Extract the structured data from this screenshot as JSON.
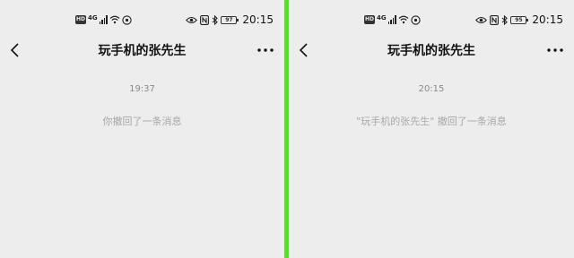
{
  "status_bar": {
    "hd_badge": "HD",
    "signal_type": "4G",
    "time": "20:15",
    "icons": [
      "hd-icon",
      "signal-icon",
      "wifi-icon",
      "hotspot-icon",
      "eye-icon",
      "nfc-icon",
      "bluetooth-icon",
      "battery-icon"
    ],
    "battery_left": "97",
    "battery_right": "95"
  },
  "left_screen": {
    "title": "玩手机的张先生",
    "timestamp": "19:37",
    "system_message": "你撤回了一条消息"
  },
  "right_screen": {
    "title": "玩手机的张先生",
    "timestamp": "20:15",
    "system_message": "\"玩手机的张先生\" 撤回了一条消息"
  },
  "colors": {
    "background": "#ededed",
    "divider": "#54e31f",
    "timestamp_text": "#8a8a8a",
    "system_text": "#a8a8a8"
  }
}
